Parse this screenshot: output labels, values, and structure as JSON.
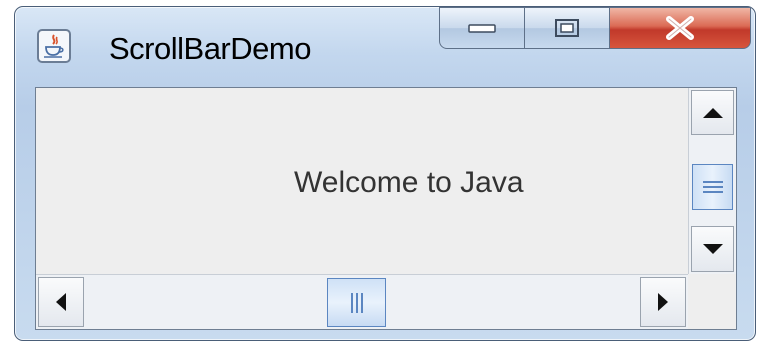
{
  "window": {
    "title": "ScrollBarDemo",
    "icon": "java-cup-icon",
    "controls": [
      "minimize-icon",
      "maximize-icon",
      "close-icon"
    ]
  },
  "content": {
    "message": "Welcome to Java"
  },
  "scrollbars": {
    "vertical": {
      "thumb_position": 0.5,
      "buttons": [
        "arrow-up-icon",
        "arrow-down-icon"
      ]
    },
    "horizontal": {
      "thumb_position": 0.5,
      "buttons": [
        "arrow-left-icon",
        "arrow-right-icon"
      ]
    }
  },
  "colors": {
    "frame": "#c3d7ee",
    "close_button": "#c1392a",
    "thumb_border": "#5b86c1",
    "client_bg": "#eeeeee"
  }
}
